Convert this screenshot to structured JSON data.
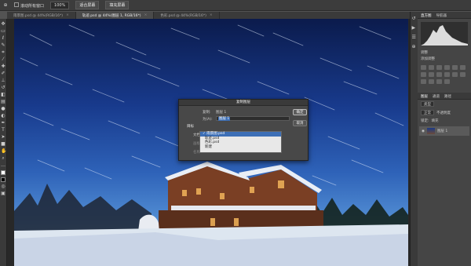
{
  "options_bar": {
    "scroll_all_windows": "滚动所有窗口",
    "zoom_percent": "100%",
    "fit_screen": "适合屏幕",
    "fill_screen": "填充屏幕"
  },
  "tabs": [
    {
      "label": "雨景图.psd @ 44%(RGB/16*)",
      "active": false
    },
    {
      "label": "轨迹.psd @ 44%(图层 1, RGB/16*)",
      "active": true
    },
    {
      "label": "色彩.psd @ 44%(RGB/16*)",
      "active": false
    }
  ],
  "dialog": {
    "title": "复制图层",
    "copy_label": "复制:",
    "copy_value": "图层 1",
    "as_label": "为(A):",
    "as_value": "图层 1",
    "target_label": "目标",
    "document_label": "文档:",
    "name_label": "名称:",
    "artboard_label": "画板:",
    "ok_label": "确定",
    "cancel_label": "取消"
  },
  "dropdown": {
    "options": [
      {
        "label": "雨景图.psd",
        "selected": true
      },
      {
        "label": "轨迹.psd",
        "selected": false
      },
      {
        "label": "色彩.psd",
        "selected": false
      },
      {
        "label": "新建",
        "selected": false
      }
    ]
  },
  "right_panel": {
    "tabs": [
      "直方图",
      "导航器"
    ],
    "adjustments_tab": "调整",
    "add_adjustment": "添加调整",
    "layer_tabs": [
      "图层",
      "通道",
      "路径"
    ],
    "kind_filter": "类型",
    "blend_mode": "正常",
    "opacity_label": "不透明度",
    "lock_label": "锁定:",
    "fill_label": "填充",
    "layer_name": "图层 1"
  },
  "colors": {
    "dialog_bg": "#484848",
    "selection": "#3d6fb6",
    "ps_bg": "#535353"
  }
}
